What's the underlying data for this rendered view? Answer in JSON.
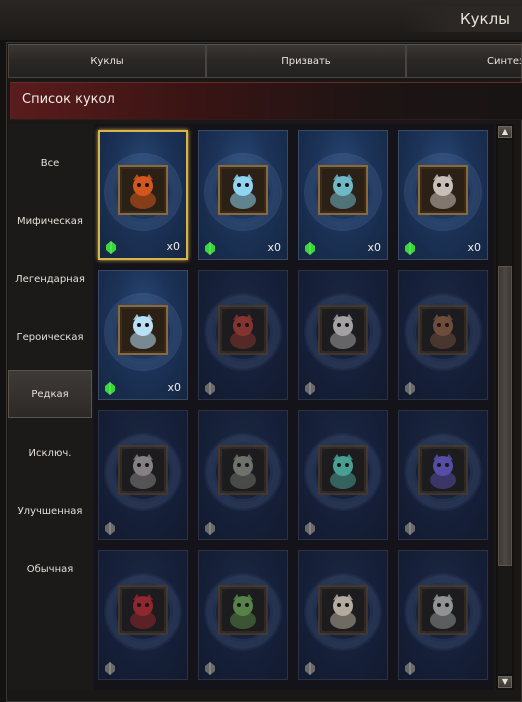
{
  "window": {
    "title": "Куклы"
  },
  "tabs": [
    {
      "label": "Куклы",
      "active": true
    },
    {
      "label": "Призвать",
      "active": false
    },
    {
      "label": "Синтез",
      "active": false
    }
  ],
  "list_header": {
    "title": "Список кукол"
  },
  "categories": [
    {
      "label": "Все",
      "active": false
    },
    {
      "label": "Мифическая",
      "active": false
    },
    {
      "label": "Легендарная",
      "active": false
    },
    {
      "label": "Героическая",
      "active": false
    },
    {
      "label": "Редкая",
      "active": true
    },
    {
      "label": "Исключ.",
      "active": false
    },
    {
      "label": "Улучшенная",
      "active": false
    },
    {
      "label": "Обычная",
      "active": false
    }
  ],
  "dolls": [
    {
      "icon": "fire-demon-doll-icon",
      "owned": true,
      "count": "x0",
      "selected": true,
      "color": "#d2571e"
    },
    {
      "icon": "ice-beast-doll-icon",
      "owned": true,
      "count": "x0",
      "selected": false,
      "color": "#8fd4f0"
    },
    {
      "icon": "frost-lady-doll-icon",
      "owned": true,
      "count": "x0",
      "selected": false,
      "color": "#6fb8c8"
    },
    {
      "icon": "armored-knight-doll-icon",
      "owned": true,
      "count": "x0",
      "selected": false,
      "color": "#c8c0b8"
    },
    {
      "icon": "crystal-spirit-doll-icon",
      "owned": true,
      "count": "x0",
      "selected": false,
      "color": "#b8e0f8"
    },
    {
      "icon": "red-imp-doll-icon",
      "owned": false,
      "count": "",
      "selected": false,
      "color": "#a83a2a"
    },
    {
      "icon": "white-hair-girl-doll-icon",
      "owned": false,
      "count": "",
      "selected": false,
      "color": "#d0ccc6"
    },
    {
      "icon": "wild-beast-doll-icon",
      "owned": false,
      "count": "",
      "selected": false,
      "color": "#8a5a3a"
    },
    {
      "icon": "skeleton-doll-icon",
      "owned": false,
      "count": "",
      "selected": false,
      "color": "#a8a09a"
    },
    {
      "icon": "stone-golem-doll-icon",
      "owned": false,
      "count": "",
      "selected": false,
      "color": "#8a8c7a"
    },
    {
      "icon": "orb-doll-icon",
      "owned": false,
      "count": "",
      "selected": false,
      "color": "#5ac8b0"
    },
    {
      "icon": "wizard-doll-icon",
      "owned": false,
      "count": "",
      "selected": false,
      "color": "#6a5ac8"
    },
    {
      "icon": "horned-demon-doll-icon",
      "owned": false,
      "count": "",
      "selected": false,
      "color": "#b8282a"
    },
    {
      "icon": "goblin-doll-icon",
      "owned": false,
      "count": "",
      "selected": false,
      "color": "#6aa24a"
    },
    {
      "icon": "monk-doll-icon",
      "owned": false,
      "count": "",
      "selected": false,
      "color": "#e8d8c0"
    },
    {
      "icon": "gray-beast-doll-icon",
      "owned": false,
      "count": "",
      "selected": false,
      "color": "#b8b8b0"
    }
  ],
  "gem_colors": {
    "owned": "#38d838",
    "locked": "#6a6a6a"
  },
  "scrollbar": {
    "up_arrow": "▲",
    "down_arrow": "▼"
  }
}
